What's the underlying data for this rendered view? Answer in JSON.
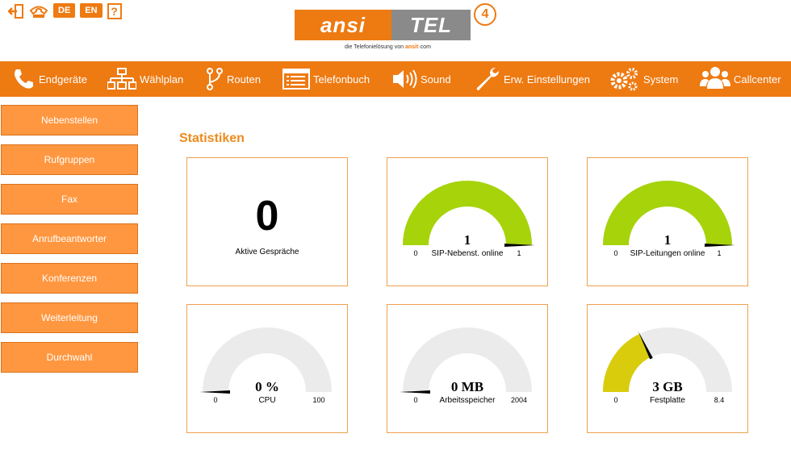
{
  "header": {
    "lang_de": "DE",
    "lang_en": "EN",
    "help": "?",
    "logo_left": "ansi",
    "logo_right": "TEL",
    "logo_version": "4",
    "tagline_prefix": "die Telefonielösung von",
    "tagline_brand": "ansit",
    "tagline_suffix": "·com"
  },
  "nav": {
    "items": [
      {
        "label": "Endgeräte",
        "icon": "phone-icon"
      },
      {
        "label": "Wählplan",
        "icon": "sitemap-icon"
      },
      {
        "label": "Routen",
        "icon": "fork-icon"
      },
      {
        "label": "Telefonbuch",
        "icon": "list-icon"
      },
      {
        "label": "Sound",
        "icon": "speaker-icon"
      },
      {
        "label": "Erw. Einstellungen",
        "icon": "wrench-icon"
      },
      {
        "label": "System",
        "icon": "gears-icon"
      },
      {
        "label": "Callcenter",
        "icon": "users-icon"
      }
    ]
  },
  "sidebar": {
    "items": [
      "Nebenstellen",
      "Rufgruppen",
      "Fax",
      "Anrufbeantworter",
      "Konferenzen",
      "Weiterleitung",
      "Durchwahl"
    ]
  },
  "main": {
    "title": "Statistiken",
    "active_calls": {
      "value": "0",
      "label": "Aktive Gespräche"
    },
    "gauges": [
      {
        "value_text": "1",
        "label": "SIP-Nebenst. online",
        "min": "0",
        "max": "1",
        "value": 1,
        "range": 1,
        "color": "#a6d30a"
      },
      {
        "value_text": "1",
        "label": "SIP-Leitungen online",
        "min": "0",
        "max": "1",
        "value": 1,
        "range": 1,
        "color": "#a6d30a"
      },
      {
        "value_text": "0 %",
        "label": "CPU",
        "min": "0",
        "max": "100",
        "value": 0,
        "range": 100,
        "color": "#a6d30a"
      },
      {
        "value_text": "0 MB",
        "label": "Arbeitsspeicher",
        "min": "0",
        "max": "2004",
        "value": 0,
        "range": 2004,
        "color": "#a6d30a"
      },
      {
        "value_text": "3 GB",
        "label": "Festplatte",
        "min": "0",
        "max": "8.4",
        "value": 3,
        "range": 8.4,
        "color": "#d8cc0c"
      }
    ],
    "gauge_track_color": "#ebebeb"
  }
}
